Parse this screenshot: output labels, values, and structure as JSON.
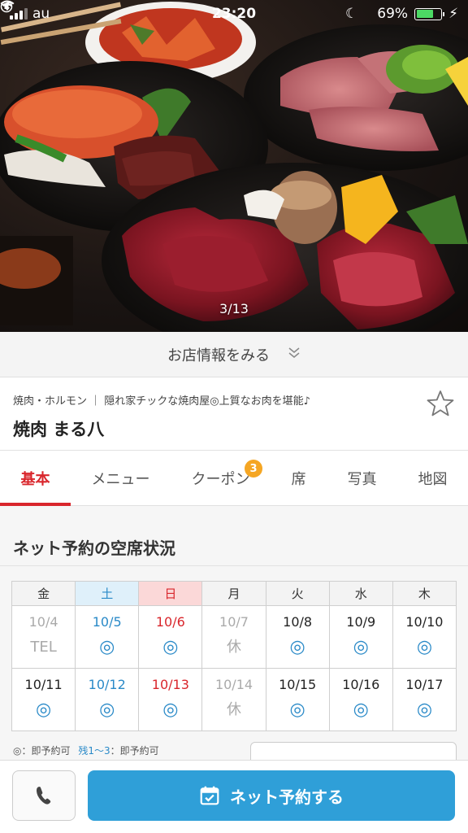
{
  "status_bar": {
    "carrier": "au",
    "time": "23:20",
    "battery": "69%",
    "battery_level": 0.69
  },
  "hero": {
    "photo_counter": "3/13"
  },
  "info_toggle": {
    "label": "お店情報をみる"
  },
  "shop": {
    "category_line": "焼肉・ホルモン ｜ 隠れ家チックな焼肉屋◎上質なお肉を堪能♪",
    "name": "焼肉 まる八"
  },
  "tabs": [
    {
      "label": "基本",
      "active": true
    },
    {
      "label": "メニュー"
    },
    {
      "label": "クーポン",
      "badge": "3"
    },
    {
      "label": "席"
    },
    {
      "label": "写真"
    },
    {
      "label": "地図"
    }
  ],
  "availability": {
    "title": "ネット予約の空席状況",
    "weekdays": [
      "金",
      "土",
      "日",
      "月",
      "火",
      "水",
      "木"
    ],
    "weeks": [
      [
        {
          "date": "10/4",
          "mark": "TEL"
        },
        {
          "date": "10/5",
          "mark": "◎"
        },
        {
          "date": "10/6",
          "mark": "◎"
        },
        {
          "date": "10/7",
          "mark": "休"
        },
        {
          "date": "10/8",
          "mark": "◎"
        },
        {
          "date": "10/9",
          "mark": "◎"
        },
        {
          "date": "10/10",
          "mark": "◎"
        }
      ],
      [
        {
          "date": "10/11",
          "mark": "◎"
        },
        {
          "date": "10/12",
          "mark": "◎"
        },
        {
          "date": "10/13",
          "mark": "◎"
        },
        {
          "date": "10/14",
          "mark": "休"
        },
        {
          "date": "10/15",
          "mark": "◎"
        },
        {
          "date": "10/16",
          "mark": "◎"
        },
        {
          "date": "10/17",
          "mark": "◎"
        }
      ]
    ],
    "legend_1": "◎：即予約可",
    "legend_2": "残1〜3",
    "legend_3": "：即予約可"
  },
  "bottom": {
    "reserve_label": "ネット予約する"
  },
  "colors": {
    "accent_red": "#d9262c",
    "accent_blue": "#2f9fd8",
    "badge_orange": "#f5a623"
  }
}
